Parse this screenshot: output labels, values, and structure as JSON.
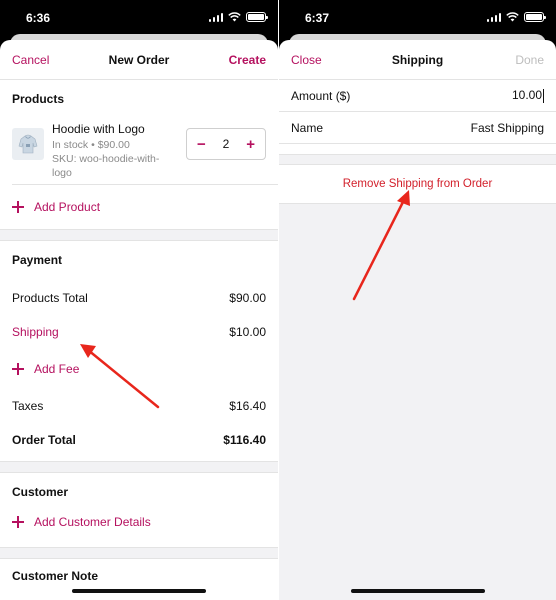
{
  "left": {
    "status_time": "6:36",
    "nav": {
      "cancel": "Cancel",
      "title": "New Order",
      "create": "Create"
    },
    "products": {
      "heading": "Products",
      "item": {
        "name": "Hoodie with Logo",
        "status_price": "In stock • $90.00",
        "sku": "SKU: woo-hoodie-with-logo",
        "quantity": "2",
        "minus": "−",
        "plus": "+"
      },
      "add_product": "Add Product"
    },
    "payment": {
      "heading": "Payment",
      "rows": [
        {
          "label": "Products Total",
          "value": "$90.00"
        },
        {
          "label": "Shipping",
          "value": "$10.00"
        }
      ],
      "add_fee": "Add Fee",
      "taxes": {
        "label": "Taxes",
        "value": "$16.40"
      },
      "order_total": {
        "label": "Order Total",
        "value": "$116.40"
      }
    },
    "customer": {
      "heading": "Customer",
      "add_details": "Add Customer Details"
    },
    "customer_note": {
      "heading": "Customer Note"
    }
  },
  "right": {
    "status_time": "6:37",
    "nav": {
      "close": "Close",
      "title": "Shipping",
      "done": "Done"
    },
    "amount": {
      "label": "Amount ($)",
      "value": "10.00"
    },
    "name": {
      "label": "Name",
      "value": "Fast Shipping"
    },
    "remove": "Remove Shipping from Order"
  },
  "colors": {
    "accent": "#b5115f",
    "destructive": "#d21f2a",
    "annotation_arrow": "#e8261c"
  }
}
